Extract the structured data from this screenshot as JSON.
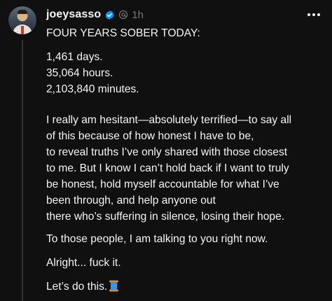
{
  "post": {
    "username": "joeysasso",
    "time": "1h",
    "title": "FOUR YEARS SOBER TODAY:",
    "stats": [
      "1,461 days.",
      "35,064 hours.",
      "2,103,840 minutes."
    ],
    "body_lines": [
      "I really am hesitant—absolutely terrified—to say all",
      "of this because of how honest I have to be,",
      "to reveal truths I’ve only shared with those closest",
      "to me. But I know I can’t hold back if I want to truly",
      "be honest, hold myself accountable for what I’ve",
      "been through, and help anyone out",
      "there who’s suffering in silence, losing their hope."
    ],
    "para3": "To those people, I am talking to you right now.",
    "para4": "Alright... fuck it.",
    "para5": "Let’s do this.",
    "icons": {
      "avatar": "avatar",
      "verified": "verified-badge-icon",
      "threads": "threads-logo-icon",
      "more": "more-options-icon",
      "emoji": "spool-of-thread-emoji"
    },
    "colors": {
      "background": "#101010",
      "text": "#f3f5f7",
      "muted": "#777777",
      "verified": "#0095f6"
    }
  }
}
